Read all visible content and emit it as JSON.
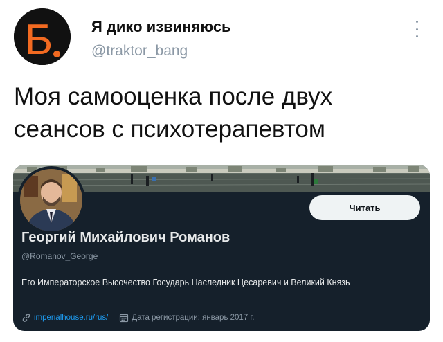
{
  "tweet": {
    "avatar_letter": "Б",
    "display_name": "Я дико извиняюсь",
    "handle": "@traktor_bang",
    "text": "Моя самооценка после двух сеансов с психотерапевтом"
  },
  "profile_card": {
    "follow_label": "Читать",
    "name": "Георгий Михайлович Романов",
    "handle": "@Romanov_George",
    "bio": "Его Императорское Высочество Государь Наследник Цесаревич и Великий Князь",
    "website": "imperialhouse.ru/rus/",
    "joined": "Дата регистрации: январь 2017 г."
  },
  "colors": {
    "brand_orange": "#f26a21",
    "card_background": "#15202b",
    "link_blue": "#1d9bf0"
  },
  "icons": [
    "more-icon",
    "link-icon",
    "calendar-icon"
  ]
}
